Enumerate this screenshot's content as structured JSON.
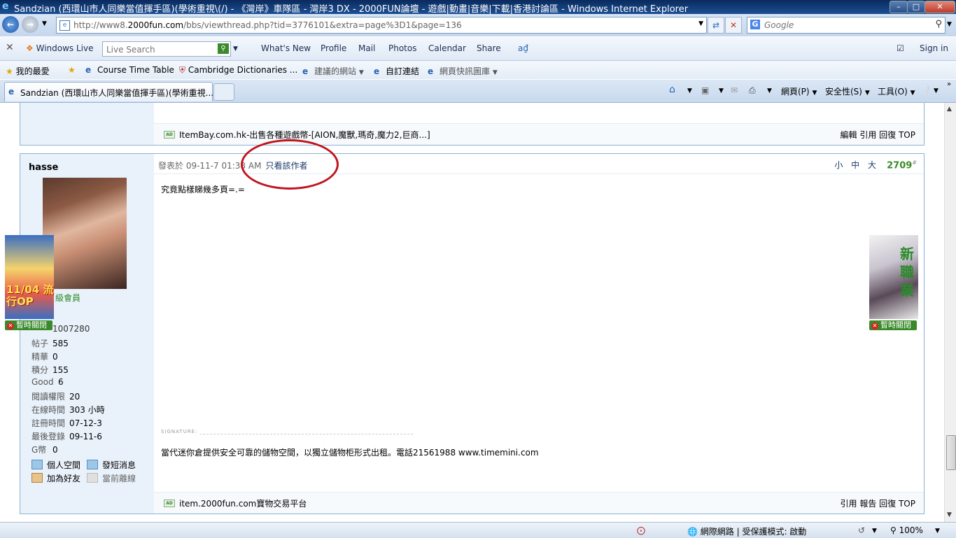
{
  "window": {
    "title": "Sandzian (西環山市人同樂當值揮手區)(學術重視\\(/) - 《灣岸》車隊區 - 灣岸3 DX - 2000FUN論壇 - 遊戲|動畫|音樂|下載|香港討論區 - Windows Internet Explorer"
  },
  "address": {
    "url_prefix": "http://www8.",
    "url_domain": "2000fun.com",
    "url_suffix": "/bbs/viewthread.php?tid=3776101&extra=page%3D1&page=136",
    "search_placeholder": "Google"
  },
  "livebar": {
    "brand": "Windows Live",
    "search_placeholder": "Live Search",
    "links": [
      "What's New",
      "Profile",
      "Mail",
      "Photos",
      "Calendar",
      "Share"
    ],
    "signin": "Sign in"
  },
  "favorites": {
    "label": "我的最愛",
    "items": [
      "Course Time Table",
      "Cambridge Dictionaries ...",
      "建議的網站",
      "自訂連結",
      "網頁快訊圖庫"
    ]
  },
  "tabs": {
    "active": "Sandzian (西環山市人同樂當值揮手區)(學術重視...",
    "tools": [
      "網頁(P)",
      "安全性(S)",
      "工具(O)"
    ]
  },
  "post_prev": {
    "ad_text": "ItemBay.com.hk-出售各種遊戲幣-[AION,魔獸,瑪奇,魔力2,巨商...]",
    "actions": "編輯 引用 回復 TOP"
  },
  "post": {
    "username": "hasse",
    "rank": "級會員",
    "uid": "1007280",
    "stats": [
      {
        "k": "帖子",
        "v": "585"
      },
      {
        "k": "精華",
        "v": "0"
      },
      {
        "k": "積分",
        "v": "155"
      },
      {
        "k": "Good",
        "v": "6"
      },
      {
        "k": "閱讀權限",
        "v": "20"
      },
      {
        "k": "在線時間",
        "v": "303 小時"
      },
      {
        "k": "註冊時間",
        "v": "07-12-3"
      },
      {
        "k": "最後登錄",
        "v": "09-11-6"
      },
      {
        "k": "G幣",
        "v": "0"
      }
    ],
    "side_actions": [
      "個人空間",
      "發短消息",
      "加為好友",
      "當前離線"
    ],
    "posted_at": "發表於 09-11-7 01:38 AM",
    "only_author": "只看該作者",
    "font_sizes": "小 中 大",
    "floor": "2709",
    "floor_suffix": "#",
    "body": "究竟點樣睇幾多頁=.=",
    "signature_label": "SIGNATURE:",
    "signature": "當代迷你倉提供安全可靠的儲物空間，以獨立儲物柜形式出租。電話21561988 www.timemini.com",
    "ad_text": "item.2000fun.com寶物交易平台",
    "actions": "引用 報告 回復 TOP"
  },
  "float_ads": {
    "left_text": "11/04 流行OP",
    "right_text": "新職業",
    "close_label": "暫時關閉"
  },
  "status": {
    "zone": "網際網路 | 受保護模式: 啟動",
    "zoom": "100%"
  }
}
